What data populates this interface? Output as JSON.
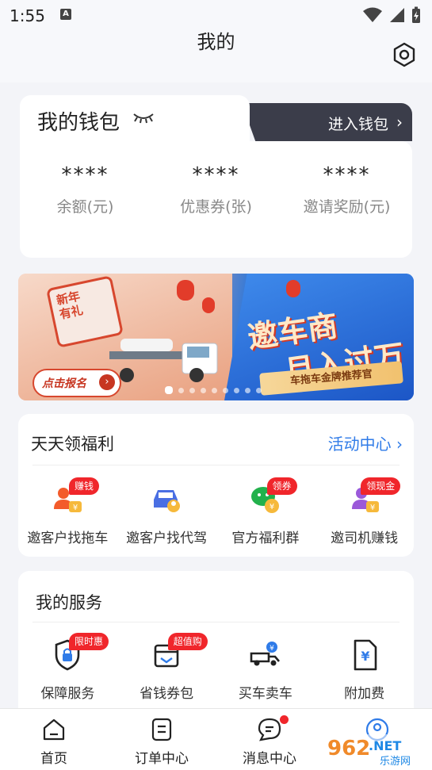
{
  "status": {
    "time": "1:55",
    "notif_icon": "A"
  },
  "header": {
    "title": "我的"
  },
  "wallet": {
    "title": "我的钱包",
    "enter_label": "进入钱包",
    "stats": [
      {
        "value": "****",
        "label": "余额(元)"
      },
      {
        "value": "****",
        "label": "优惠券(张)"
      },
      {
        "value": "****",
        "label": "邀请奖励(元)"
      }
    ]
  },
  "banner": {
    "phone_text_1": "新年",
    "phone_text_2": "有礼",
    "headline_1": "邀车商",
    "headline_2": "月入过万",
    "ribbon": "车拖车金牌推荐官",
    "cta": "点击报名",
    "dots_total": 9,
    "dots_active_index": 0
  },
  "daily": {
    "title": "天天领福利",
    "link": "活动中心",
    "items": [
      {
        "label": "邀客户找拖车",
        "badge": "赚钱",
        "icon": "person-coin-icon"
      },
      {
        "label": "邀客户找代驾",
        "badge": "",
        "icon": "car-person-icon"
      },
      {
        "label": "官方福利群",
        "badge": "领券",
        "icon": "wechat-coin-icon"
      },
      {
        "label": "邀司机赚钱",
        "badge": "领现金",
        "icon": "driver-coin-icon"
      }
    ]
  },
  "services": {
    "title": "我的服务",
    "items": [
      {
        "label": "保障服务",
        "badge": "限时惠",
        "icon": "shield-lock-icon"
      },
      {
        "label": "省钱券包",
        "badge": "超值购",
        "icon": "coupon-wallet-icon"
      },
      {
        "label": "买车卖车",
        "badge": "",
        "icon": "truck-yuan-icon"
      },
      {
        "label": "附加费",
        "badge": "",
        "icon": "yuan-document-icon"
      }
    ]
  },
  "nav": {
    "items": [
      {
        "label": "首页"
      },
      {
        "label": "订单中心"
      },
      {
        "label": "消息中心"
      }
    ]
  },
  "watermark": {
    "text_1": "962",
    "text_2": ".NET",
    "text_3": "乐游网"
  },
  "colors": {
    "accent": "#2f7be8",
    "badge": "#f0262b",
    "dark_tab": "#3b3d4a"
  }
}
